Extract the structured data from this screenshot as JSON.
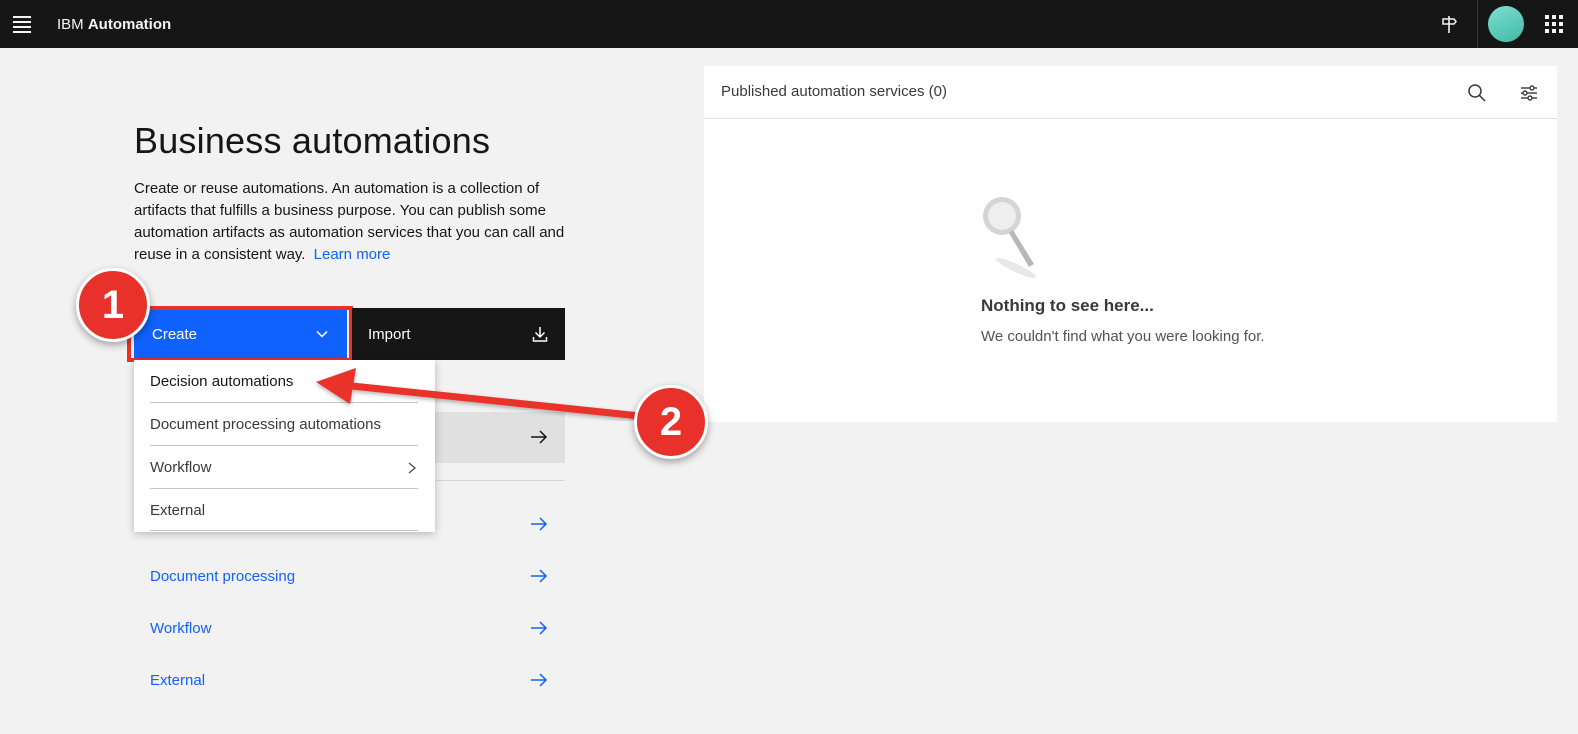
{
  "header": {
    "brand_prefix": "IBM",
    "brand_name": "Automation",
    "icons": [
      "menu-icon",
      "signpost-icon",
      "avatar",
      "app-switcher-icon"
    ]
  },
  "main": {
    "title": "Business automations",
    "description": "Create or reuse automations. An automation is a collection of artifacts that fulfills a business purpose. You can publish some automation artifacts as automation services that you can call and reuse in a consistent way.",
    "learn_more": "Learn more",
    "create_label": "Create",
    "import_label": "Import",
    "links": [
      "Document processing",
      "Workflow",
      "External"
    ]
  },
  "dropdown": {
    "items": [
      {
        "label": "Decision automations"
      },
      {
        "label": "Document processing automations"
      },
      {
        "label": "Workflow"
      },
      {
        "label": "External"
      }
    ]
  },
  "panel": {
    "title": "Published automation services (0)",
    "empty_title": "Nothing to see here...",
    "empty_subtitle": "We couldn't find what you were looking for."
  },
  "annotations": {
    "step1": "1",
    "step2": "2"
  },
  "colors": {
    "accent": "#0f62fe",
    "header_bg": "#161616",
    "annotation_red": "#e8312a"
  }
}
